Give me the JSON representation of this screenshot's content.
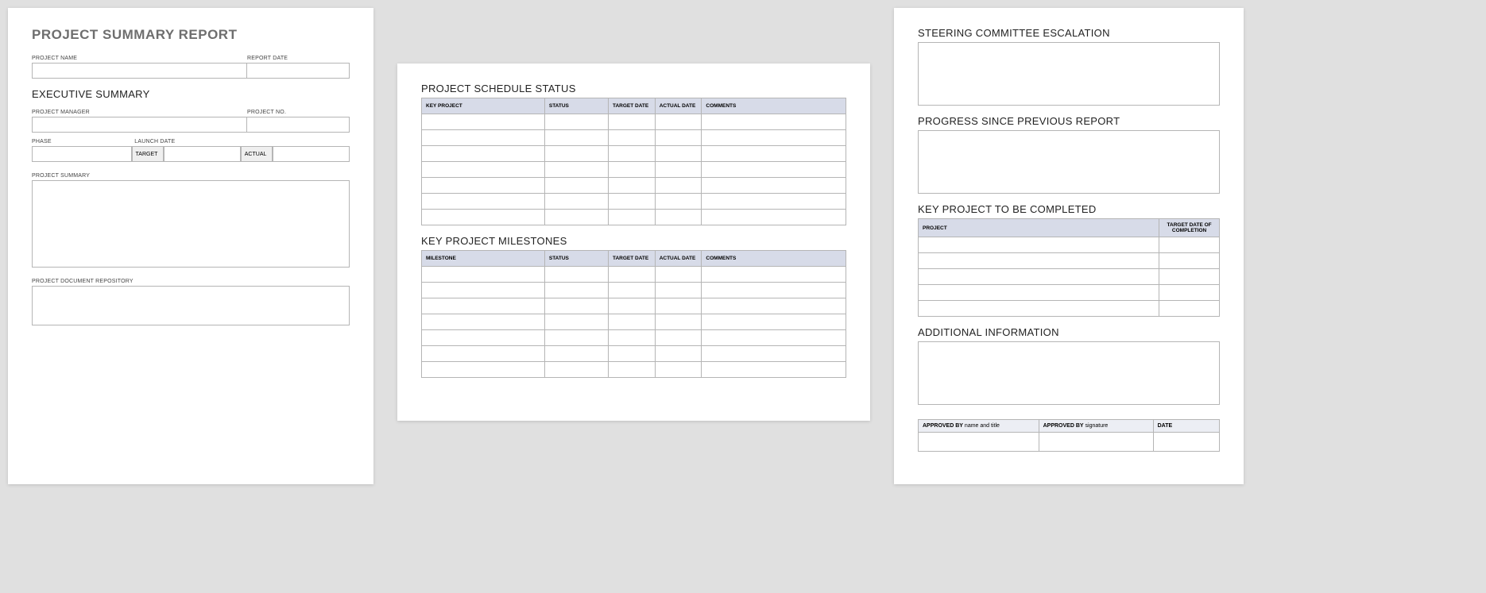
{
  "page1": {
    "docTitle": "PROJECT SUMMARY REPORT",
    "projectNameLabel": "PROJECT NAME",
    "reportDateLabel": "REPORT DATE",
    "execSummaryTitle": "EXECUTIVE SUMMARY",
    "projectManagerLabel": "PROJECT MANAGER",
    "projectNoLabel": "PROJECT NO.",
    "phaseLabel": "PHASE",
    "launchDateLabel": "LAUNCH DATE",
    "targetLabel": "TARGET",
    "actualLabel": "ACTUAL",
    "projectSummaryLabel": "PROJECT SUMMARY",
    "repositoryLabel": "PROJECT DOCUMENT REPOSITORY"
  },
  "page2": {
    "scheduleTitle": "PROJECT SCHEDULE STATUS",
    "scheduleHeaders": {
      "keyProject": "KEY PROJECT",
      "status": "STATUS",
      "targetDate": "TARGET DATE",
      "actualDate": "ACTUAL DATE",
      "comments": "COMMENTS"
    },
    "milestonesTitle": "KEY PROJECT MILESTONES",
    "milestonesHeaders": {
      "milestone": "MILESTONE",
      "status": "STATUS",
      "targetDate": "TARGET DATE",
      "actualDate": "ACTUAL DATE",
      "comments": "COMMENTS"
    }
  },
  "page3": {
    "steeringTitle": "STEERING COMMITTEE ESCALATION",
    "progressTitle": "PROGRESS SINCE PREVIOUS REPORT",
    "keyProjectTitle": "KEY PROJECT TO BE COMPLETED",
    "keyProjectHeaders": {
      "project": "PROJECT",
      "targetDate": "TARGET DATE OF COMPLETION"
    },
    "additionalTitle": "ADDITIONAL INFORMATION",
    "approval": {
      "approvedByBold": "APPROVED BY",
      "nameAndTitle": "name and title",
      "signature": "signature",
      "date": "DATE"
    }
  }
}
